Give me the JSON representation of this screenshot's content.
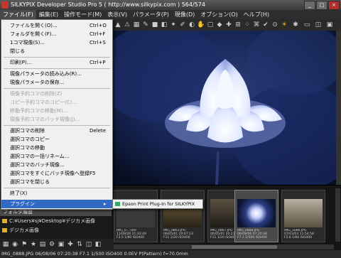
{
  "window": {
    "title": "SILKYPIX Developer Studio Pro 5 ( http://www.silkypix.com )   564/574"
  },
  "menubar": [
    {
      "label": "ファイル(F)"
    },
    {
      "label": "編集(E)"
    },
    {
      "label": "操作モード(M)"
    },
    {
      "label": "表示(V)"
    },
    {
      "label": "パラメータ(P)"
    },
    {
      "label": "現像(D)"
    },
    {
      "label": "オプション(O)"
    },
    {
      "label": "ヘルプ(H)"
    }
  ],
  "file_menu": {
    "items": [
      {
        "label": "ファイルを開く(O)...",
        "shortcut": "Ctrl+O"
      },
      {
        "label": "フォルダを開く(F)...",
        "shortcut": "Ctrl+F"
      },
      {
        "label": "1コマ現像(S)...",
        "shortcut": "Ctrl+S"
      },
      {
        "label": "閉じる",
        "shortcut": ""
      },
      {
        "label": "印刷(P)...",
        "shortcut": "Ctrl+P"
      },
      {
        "label": "現像パラメータの読み込み(R)...",
        "shortcut": ""
      },
      {
        "label": "現像パラメータの保存...",
        "shortcut": ""
      },
      {
        "label": "現像予約コマの削除(Z)",
        "shortcut": ""
      },
      {
        "label": "コピー予約コマのコピー(C)...",
        "shortcut": ""
      },
      {
        "label": "移動予約コマの移動(M)...",
        "shortcut": ""
      },
      {
        "label": "現像予約コマのバッチ現像(J)...",
        "shortcut": ""
      },
      {
        "label": "選択コマの削除",
        "shortcut": "Delete"
      },
      {
        "label": "選択コマのコピー",
        "shortcut": ""
      },
      {
        "label": "選択コマの移動",
        "shortcut": ""
      },
      {
        "label": "選択コマの一括リネーム...",
        "shortcut": ""
      },
      {
        "label": "選択コマのバッチ現像...",
        "shortcut": ""
      },
      {
        "label": "選択コマをすぐにバッチ現像へ登録",
        "shortcut": "F5"
      },
      {
        "label": "選択コマを閉じる",
        "shortcut": ""
      },
      {
        "label": "終了(X)",
        "shortcut": ""
      },
      {
        "label": "プラグイン",
        "shortcut": "▸"
      }
    ]
  },
  "plugin_submenu": {
    "label": "Epson Print Plug-In for SILKYPIX"
  },
  "folder_panel": {
    "header": "フォルダ履歴",
    "items": [
      {
        "label": "C:¥Users¥sj¥Desktop¥デジカメ画像"
      },
      {
        "label": "デジカメ画像"
      }
    ]
  },
  "thumbnails": [
    {
      "name": "IMG_0....ORF",
      "line2": "11/09/26 21:33:49",
      "line3": "F3.5 1/80 ISO400"
    },
    {
      "name": "IMG_0863.JPG",
      "line2": "06/05/01 20:07:13",
      "line3": "F11 1/20 ISO400"
    },
    {
      "name": "IMG_0867.JPG",
      "line2": "06/05/01 20:21:32",
      "line3": "F11 1/20 ISO400"
    },
    {
      "name": "IMG_0888.JPG",
      "line2": "06/08/06 07:20:38",
      "line3": "F7.1 1/500 ISO400"
    },
    {
      "name": "IMG_1086.JPG",
      "line2": "07/03/03 11:54:58",
      "line3": "F5.6 1/60 ISO400"
    }
  ],
  "statusbar": {
    "text": "IMG_0888.JPG 06/08/06 07:20:38 F7.1 1/500 ISO400  0.0EV P(Pattern) f=70.0mm"
  }
}
